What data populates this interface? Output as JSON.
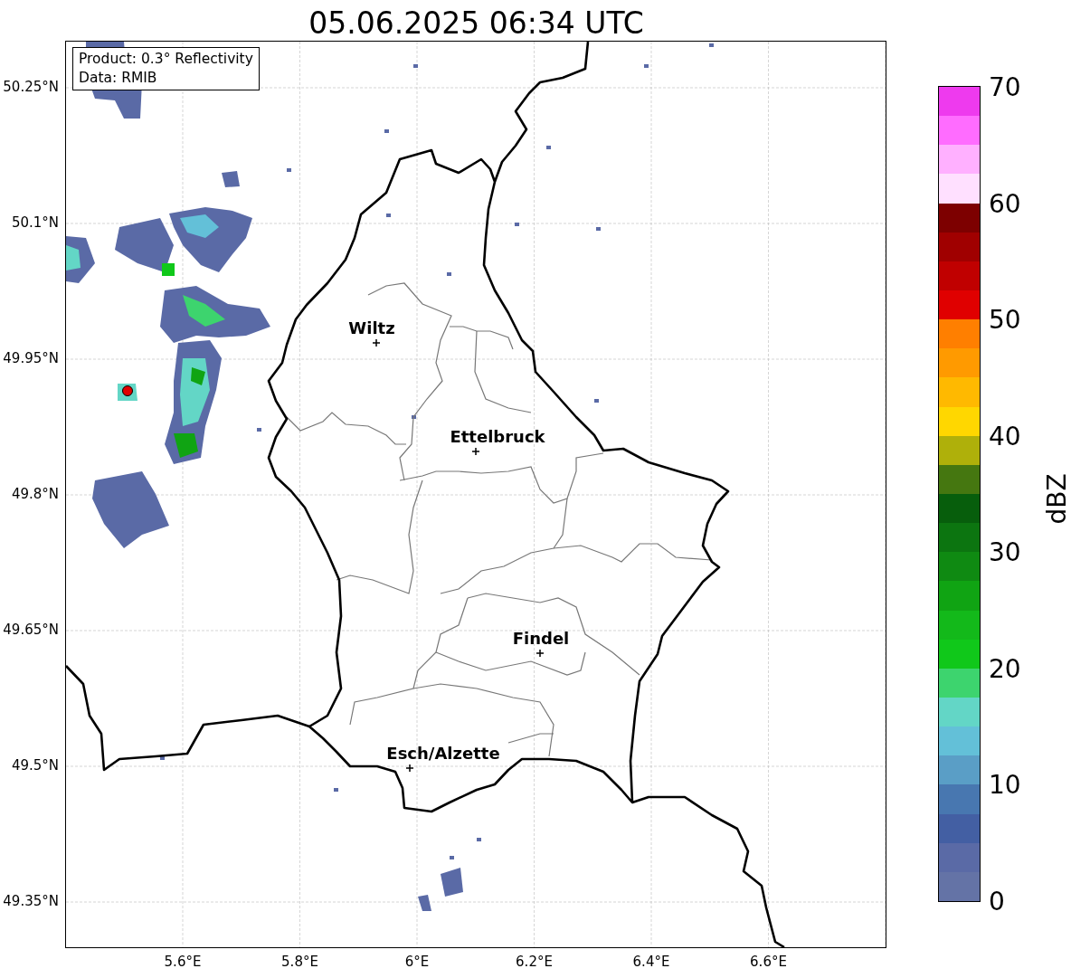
{
  "title": "05.06.2025 06:34 UTC",
  "info_box": {
    "lines": [
      "Product: 0.3° Reflectivity",
      "Data: RMIB"
    ]
  },
  "map": {
    "y_ticks": [
      "50.25°N",
      "50.1°N",
      "49.95°N",
      "49.8°N",
      "49.65°N",
      "49.5°N",
      "49.35°N"
    ],
    "x_ticks": [
      "5.6°E",
      "5.8°E",
      "6°E",
      "6.2°E",
      "6.4°E",
      "6.6°E"
    ],
    "cities": [
      "Wiltz",
      "Ettelbruck",
      "Findel",
      "Esch/Alzette"
    ]
  },
  "colorbar": {
    "label": "dBZ",
    "ticks": [
      "70",
      "60",
      "50",
      "40",
      "30",
      "20",
      "10",
      "0"
    ],
    "segments": [
      {
        "color": "#6473a6"
      },
      {
        "color": "#5a6aa6"
      },
      {
        "color": "#435fa3"
      },
      {
        "color": "#4877b0"
      },
      {
        "color": "#5a9ec6"
      },
      {
        "color": "#63c0d8"
      },
      {
        "color": "#63d6c6"
      },
      {
        "color": "#3dd46e"
      },
      {
        "color": "#10c81a"
      },
      {
        "color": "#13b91a"
      },
      {
        "color": "#10a413"
      },
      {
        "color": "#0f8a12"
      },
      {
        "color": "#0c7510"
      },
      {
        "color": "#075e0c"
      },
      {
        "color": "#457710"
      },
      {
        "color": "#afb00a"
      },
      {
        "color": "#ffd700"
      },
      {
        "color": "#ffb900"
      },
      {
        "color": "#ff9a00"
      },
      {
        "color": "#ff7f00"
      },
      {
        "color": "#e00000"
      },
      {
        "color": "#c00000"
      },
      {
        "color": "#a00000"
      },
      {
        "color": "#7d0000"
      },
      {
        "color": "#ffe0ff"
      },
      {
        "color": "#ffb0ff"
      },
      {
        "color": "#ff6cff"
      },
      {
        "color": "#ee3aee"
      }
    ]
  }
}
